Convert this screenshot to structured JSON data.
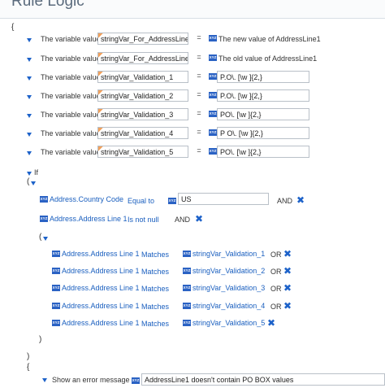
{
  "header": {
    "title": "Rule Logic"
  },
  "braces": {
    "open": "{",
    "close": "}",
    "group_open": "(",
    "group_close": ")"
  },
  "variables": [
    {
      "label": "The variable value",
      "name": "stringVar_For_AddressLine1",
      "op": "=",
      "value": "The new value of AddressLine1",
      "value_is_text": true
    },
    {
      "label": "The variable value",
      "name": "stringVar_For_AddressLine1",
      "op": "=",
      "value": "The old value of AddressLine1",
      "value_is_text": true
    },
    {
      "label": "The variable value",
      "name": "stringVar_Validation_1",
      "op": "=",
      "value": "P.O\\. [\\w ]{2,}",
      "value_is_text": false
    },
    {
      "label": "The variable value",
      "name": "stringVar_Validation_2",
      "op": "=",
      "value": "P.O\\. [\\w ]{2,}",
      "value_is_text": false
    },
    {
      "label": "The variable value",
      "name": "stringVar_Validation_3",
      "op": "=",
      "value": "PO\\. [\\w ]{2,}",
      "value_is_text": false
    },
    {
      "label": "The variable value",
      "name": "stringVar_Validation_4",
      "op": "=",
      "value": "P O\\. [\\w ]{2,}",
      "value_is_text": false
    },
    {
      "label": "The variable value",
      "name": "stringVar_Validation_5",
      "op": "=",
      "value": "PO\\. [\\w ]{2,}",
      "value_is_text": false
    }
  ],
  "if_block": {
    "keyword": "If",
    "conditions": [
      {
        "field": "Address.Country Code",
        "operator": "Equal to",
        "value": "US",
        "conj": "AND"
      },
      {
        "field": "Address.Address Line 1",
        "operator": "Is not null",
        "conj": "AND"
      }
    ],
    "nested": [
      {
        "field": "Address.Address Line 1",
        "operator": "Matches",
        "var": "stringVar_Validation_1",
        "conj": "OR"
      },
      {
        "field": "Address.Address Line 1",
        "operator": "Matches",
        "var": "stringVar_Validation_2",
        "conj": "OR"
      },
      {
        "field": "Address.Address Line 1",
        "operator": "Matches",
        "var": "stringVar_Validation_3",
        "conj": "OR"
      },
      {
        "field": "Address.Address Line 1",
        "operator": "Matches",
        "var": "stringVar_Validation_4",
        "conj": "OR"
      },
      {
        "field": "Address.Address Line 1",
        "operator": "Matches",
        "var": "stringVar_Validation_5",
        "conj": ""
      }
    ]
  },
  "then_block": {
    "action_label": "Show an error message",
    "message": "AddressLine1 doesn't contain PO BOX values"
  },
  "tag_text": "XYZ",
  "close_glyph": "✖"
}
